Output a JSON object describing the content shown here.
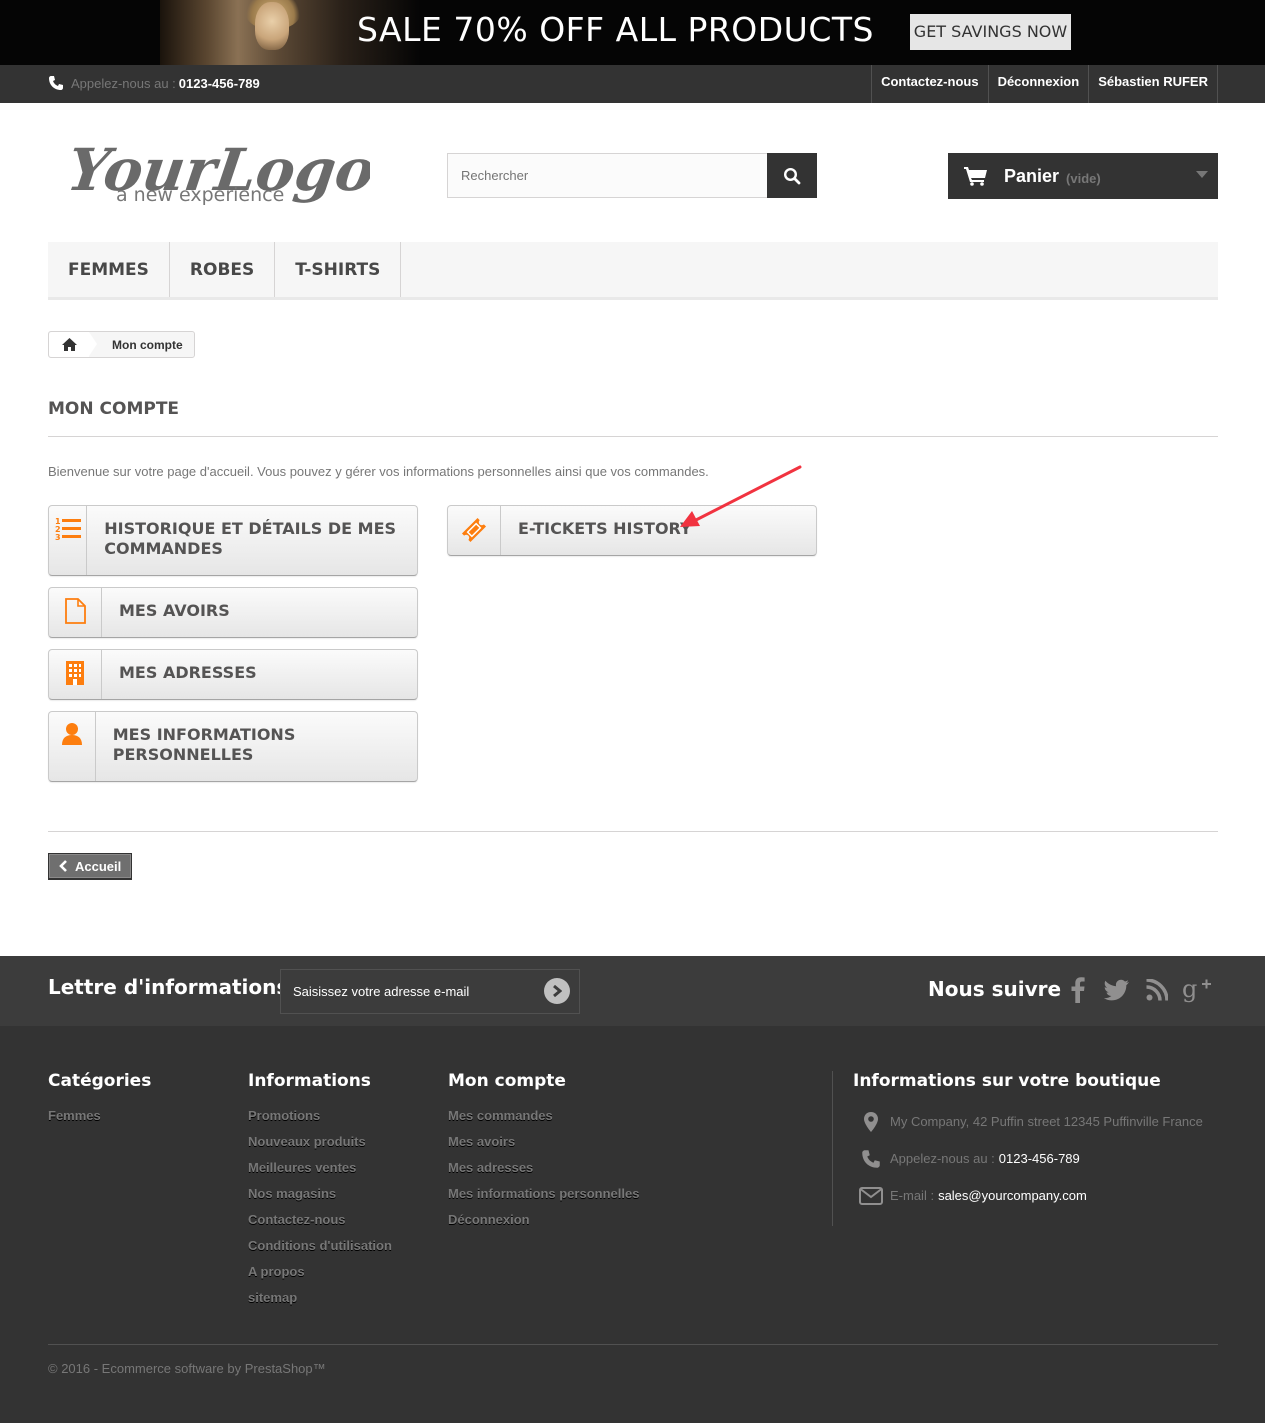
{
  "promo": {
    "title": "SALE 70% OFF ALL PRODUCTS",
    "button_label": "GET SAVINGS NOW"
  },
  "topnav": {
    "phone_label": "Appelez-nous au :",
    "phone_number": "0123-456-789",
    "links": [
      "Contactez-nous",
      "Déconnexion",
      "Sébastien RUFER"
    ]
  },
  "header": {
    "logo_line1": "YourLogo",
    "logo_line2": "a new experience",
    "search_placeholder": "Rechercher",
    "cart_label": "Panier",
    "cart_quantity": "(vide)"
  },
  "menu": [
    "FEMMES",
    "ROBES",
    "T-SHIRTS"
  ],
  "breadcrumb": {
    "current": "Mon compte"
  },
  "page": {
    "title": "MON COMPTE",
    "welcome": "Bienvenue sur votre page d'accueil. Vous pouvez y gérer vos informations personnelles ainsi que vos commandes.",
    "buttons": [
      {
        "label": "HISTORIQUE ET DÉTAILS DE MES COMMANDES",
        "icon": "ordered-list-icon"
      },
      {
        "label": "MES AVOIRS",
        "icon": "document-icon"
      },
      {
        "label": "MES ADRESSES",
        "icon": "building-icon"
      },
      {
        "label": "MES INFORMATIONS PERSONNELLES",
        "icon": "user-icon"
      },
      {
        "label": "E-TICKETS HISTORY",
        "icon": "ticket-icon"
      }
    ],
    "home_button": "Accueil",
    "accent_color": "#f13340",
    "icon_color": "#fd7e0f"
  },
  "newsletter": {
    "title": "Lettre d'informations",
    "placeholder": "Saisissez votre adresse e-mail"
  },
  "social": {
    "title": "Nous suivre",
    "icons": [
      "facebook-icon",
      "twitter-icon",
      "rss-icon",
      "google-plus-icon"
    ]
  },
  "footer": {
    "categories": {
      "title": "Catégories",
      "items": [
        "Femmes"
      ]
    },
    "informations": {
      "title": "Informations",
      "items": [
        "Promotions",
        "Nouveaux produits",
        "Meilleures ventes",
        "Nos magasins",
        "Contactez-nous",
        "Conditions d'utilisation",
        "A propos",
        "sitemap"
      ]
    },
    "account": {
      "title": "Mon compte",
      "items": [
        "Mes commandes",
        "Mes avoirs",
        "Mes adresses",
        "Mes informations personnelles",
        "Déconnexion"
      ]
    },
    "store": {
      "title": "Informations sur votre boutique",
      "address": "My Company, 42 Puffin street 12345 Puffinville France",
      "phone_label": "Appelez-nous au :",
      "phone": "0123-456-789",
      "email_label": "E-mail :",
      "email": "sales@yourcompany.com"
    },
    "copyright": "© 2016 - Ecommerce software by PrestaShop™"
  }
}
